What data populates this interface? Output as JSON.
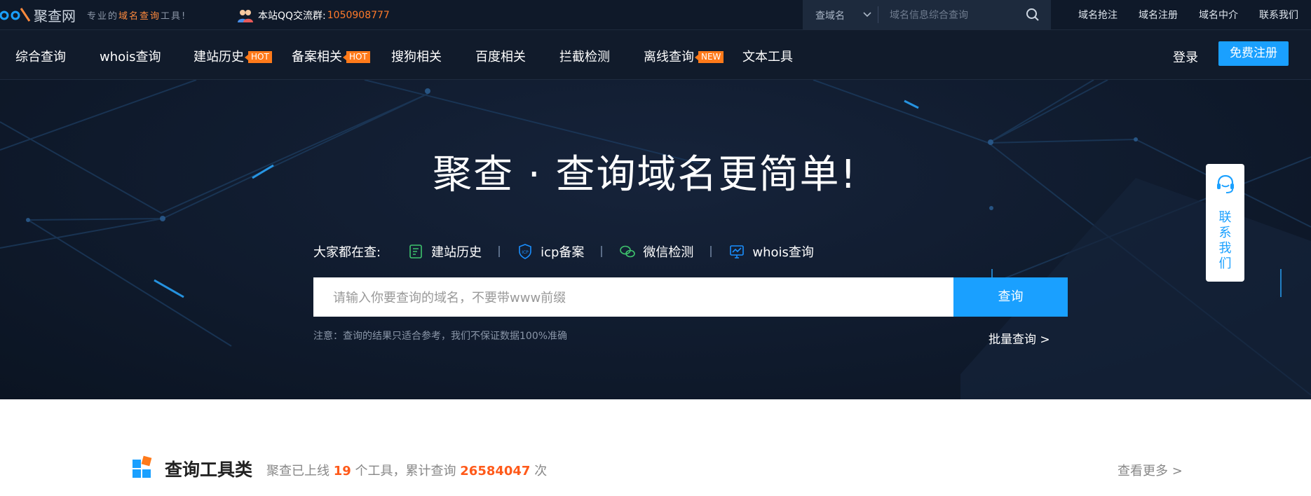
{
  "topbar": {
    "logo_name": "聚查网",
    "slogan_prefix": "专业的",
    "slogan_highlight": "域名查询",
    "slogan_suffix": "工具!",
    "qq_label": "本站QQ交流群:",
    "qq_number": "1050908777",
    "search_select": "查域名",
    "search_placeholder": "域名信息综合查询",
    "links": [
      "域名抢注",
      "域名注册",
      "域名中介",
      "联系我们"
    ]
  },
  "nav": {
    "items": [
      {
        "label": "综合查询",
        "badge": ""
      },
      {
        "label": "whois查询",
        "badge": ""
      },
      {
        "label": "建站历史",
        "badge": "HOT"
      },
      {
        "label": "备案相关",
        "badge": "HOT"
      },
      {
        "label": "搜狗相关",
        "badge": ""
      },
      {
        "label": "百度相关",
        "badge": ""
      },
      {
        "label": "拦截检测",
        "badge": ""
      },
      {
        "label": "离线查询",
        "badge": "NEW"
      },
      {
        "label": "文本工具",
        "badge": ""
      }
    ],
    "login": "登录",
    "register": "免费注册"
  },
  "hero": {
    "title": "聚查 · 查询域名更简单!",
    "hot_label": "大家都在查:",
    "hot_items": [
      {
        "label": "建站历史",
        "icon": "history-icon",
        "color": "#3ec46d"
      },
      {
        "label": "icp备案",
        "icon": "icp-shield-icon",
        "color": "#1a8fff"
      },
      {
        "label": "微信检测",
        "icon": "wechat-icon",
        "color": "#3ec46d"
      },
      {
        "label": "whois查询",
        "icon": "whois-monitor-icon",
        "color": "#1a8fff"
      }
    ],
    "search_placeholder": "请输入你要查询的域名，不要带www前缀",
    "search_button": "查询",
    "note": "注意：查询的结果只适合参考，我们不保证数据100%准确",
    "batch_link": "批量查询 >"
  },
  "contact": {
    "label": "联系我们"
  },
  "section": {
    "title": "查询工具类",
    "sub_prefix": "聚查已上线",
    "tool_count": "19",
    "sub_middle": "个工具，累计查询",
    "query_count": "26584047",
    "sub_suffix": "次",
    "more": "查看更多 >"
  },
  "colors": {
    "accent": "#1aa0ff",
    "hot_badge": "#ff7a1a",
    "highlight_number": "#ff5a1a",
    "dark_bg": "#0f1929"
  }
}
